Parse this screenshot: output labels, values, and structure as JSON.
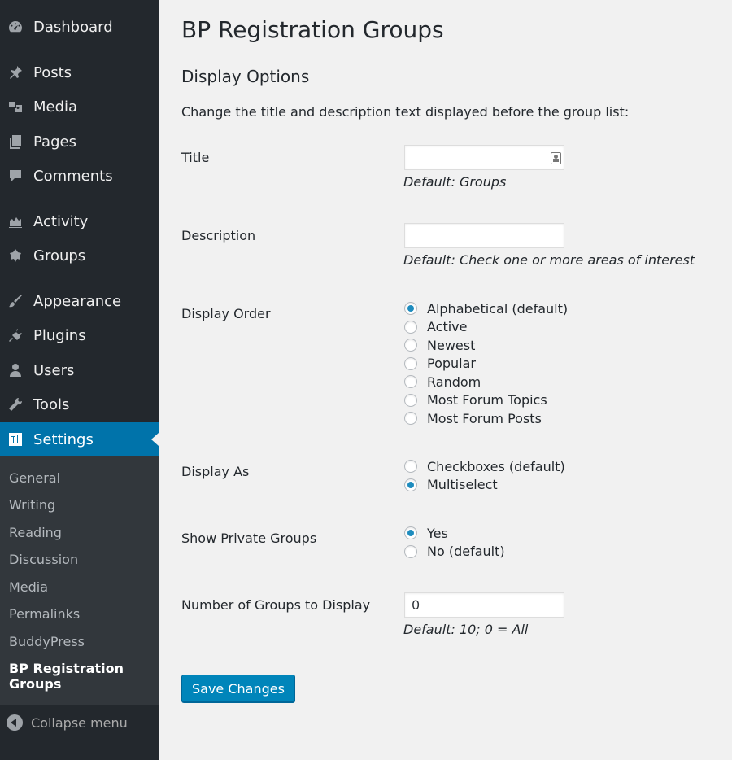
{
  "sidebar": {
    "items": [
      {
        "label": "Dashboard",
        "icon": "dashboard-icon"
      },
      {
        "label": "Posts",
        "icon": "pin-icon"
      },
      {
        "label": "Media",
        "icon": "media-icon"
      },
      {
        "label": "Pages",
        "icon": "pages-icon"
      },
      {
        "label": "Comments",
        "icon": "comment-icon"
      },
      {
        "label": "Activity",
        "icon": "activity-icon"
      },
      {
        "label": "Groups",
        "icon": "groups-icon"
      },
      {
        "label": "Appearance",
        "icon": "brush-icon"
      },
      {
        "label": "Plugins",
        "icon": "plug-icon"
      },
      {
        "label": "Users",
        "icon": "user-icon"
      },
      {
        "label": "Tools",
        "icon": "wrench-icon"
      },
      {
        "label": "Settings",
        "icon": "settings-icon"
      }
    ],
    "submenu": [
      "General",
      "Writing",
      "Reading",
      "Discussion",
      "Media",
      "Permalinks",
      "BuddyPress",
      "BP Registration Groups"
    ],
    "collapse_label": "Collapse menu"
  },
  "page": {
    "title": "BP Registration Groups",
    "section_title": "Display Options",
    "intro": "Change the title and description text displayed before the group list:"
  },
  "form": {
    "title_label": "Title",
    "title_value": "",
    "title_hint": "Default: Groups",
    "description_label": "Description",
    "description_value": "",
    "description_hint": "Default: Check one or more areas of interest",
    "order_label": "Display Order",
    "order_options": [
      "Alphabetical (default)",
      "Active",
      "Newest",
      "Popular",
      "Random",
      "Most Forum Topics",
      "Most Forum Posts"
    ],
    "order_selected": "Alphabetical (default)",
    "display_as_label": "Display As",
    "display_as_options": [
      "Checkboxes (default)",
      "Multiselect"
    ],
    "display_as_selected": "Multiselect",
    "private_label": "Show Private Groups",
    "private_options": [
      "Yes",
      "No (default)"
    ],
    "private_selected": "Yes",
    "number_label": "Number of Groups to Display",
    "number_value": "0",
    "number_hint": "Default: 10; 0 = All",
    "save_label": "Save Changes"
  },
  "colors": {
    "accent": "#0073aa",
    "sidebar": "#23282d",
    "radio_dot": "#1e8cbe"
  }
}
